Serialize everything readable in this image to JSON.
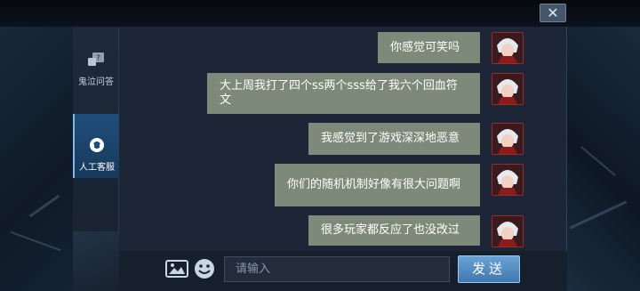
{
  "window": {
    "close_label": "✕"
  },
  "sidebar": {
    "items": [
      {
        "label": "鬼泣问答",
        "icon": "faq-icon",
        "active": false
      },
      {
        "label": "人工客服",
        "icon": "headset-icon",
        "active": true
      }
    ]
  },
  "chat": {
    "messages": [
      {
        "text": "你感觉可笑吗",
        "sender": "user"
      },
      {
        "text": "大上周我打了四个ss两个sss给了我六个回血符文",
        "sender": "user"
      },
      {
        "text": "我感觉到了游戏深深地恶意",
        "sender": "user"
      },
      {
        "text": "你们的随机机制好像有很大问题啊",
        "sender": "user"
      },
      {
        "text": "很多玩家都反应了也没改过",
        "sender": "user"
      }
    ]
  },
  "input": {
    "placeholder": "请输入",
    "value": "",
    "send_label": "发送",
    "image_icon": "image-icon",
    "emoji_icon": "emoji-icon"
  },
  "colors": {
    "bubble": "#7d8a79",
    "panel": "#1c2636",
    "accent": "#4f8cc4"
  }
}
